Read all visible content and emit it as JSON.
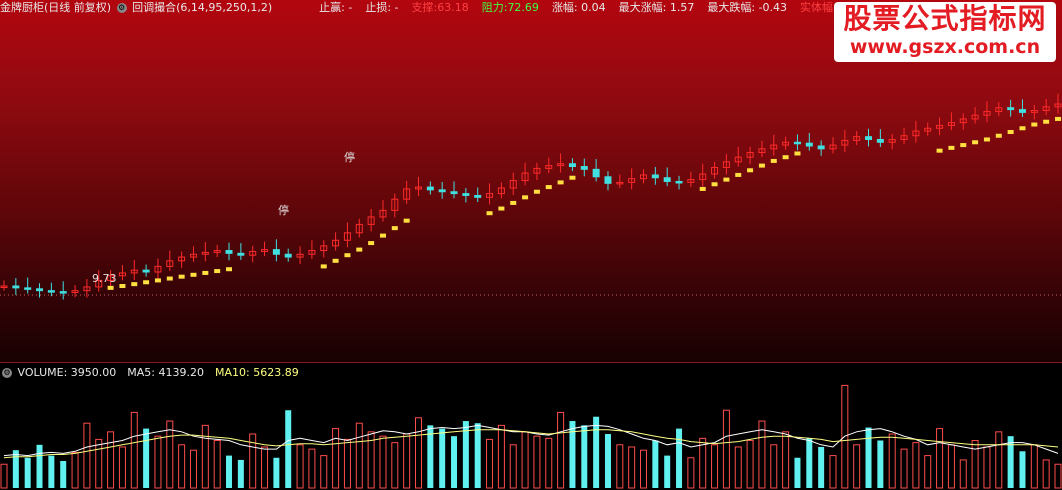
{
  "header": {
    "stock_name": "金牌厨柜(日线 前复权)",
    "indicator_name": "回调撮合(6,14,95,250,1,2)",
    "take_profit": "止赢: -",
    "stop_loss": "止损: -",
    "support_label": "支撑: ",
    "support_value": "63.18",
    "resistance_label": "阻力: ",
    "resistance_value": "72.69",
    "change": "涨幅: 0.04",
    "max_rise": "最大涨幅: 1.57",
    "max_fall": "最大跌幅: -0.43",
    "body_range": "实体幅: 0.03",
    "colors": {
      "support": "#ff4040",
      "resistance": "#40ff40",
      "bodyrange": "#ff4040"
    }
  },
  "volume_header": {
    "volume": "VOLUME: 3950.00",
    "ma5": "MA5: 4139.20",
    "ma10": "MA10: 5623.89",
    "colors": {
      "volume": "#e8e8e8",
      "ma5": "#e8e8e8",
      "ma10": "#ffff80"
    }
  },
  "watermark": {
    "title": "股票公式指标网",
    "url": "www.gszx.com.cn"
  },
  "chart_data": {
    "type": "candlestick",
    "low_label": "9.73",
    "signal_labels": [
      "停",
      "停"
    ],
    "up_color": "#ff2a2a",
    "down_color": "#40e0e0",
    "trend_color": "#ffe040",
    "volume_up_color": "#ff4d4d",
    "volume_down_color": "#60f0f0",
    "price_range": [
      60,
      90
    ],
    "volume_range": [
      0,
      100
    ],
    "price_path": [
      61.5,
      61.3,
      61.2,
      61.0,
      60.9,
      60.8,
      61.0,
      61.4,
      62.1,
      62.6,
      62.9,
      63.2,
      63.0,
      63.6,
      64.2,
      64.6,
      64.9,
      65.1,
      65.3,
      65.0,
      64.8,
      65.2,
      65.4,
      64.9,
      64.6,
      64.9,
      65.3,
      65.8,
      66.4,
      67.2,
      68.1,
      68.9,
      69.6,
      70.8,
      71.9,
      72.1,
      71.8,
      71.6,
      71.4,
      71.2,
      71.0,
      71.4,
      72.0,
      72.8,
      73.6,
      74.1,
      74.4,
      74.6,
      74.3,
      74.0,
      73.2,
      72.5,
      72.6,
      73.0,
      73.4,
      73.1,
      72.7,
      72.6,
      72.9,
      73.5,
      74.2,
      74.8,
      75.3,
      75.8,
      76.2,
      76.6,
      76.9,
      76.8,
      76.5,
      76.2,
      76.6,
      77.1,
      77.5,
      77.2,
      76.9,
      77.2,
      77.6,
      78.1,
      78.4,
      78.7,
      79.0,
      79.4,
      79.8,
      80.2,
      80.6,
      80.4,
      80.1,
      80.3,
      80.7,
      81.0
    ],
    "trend_path": [
      null,
      null,
      null,
      null,
      null,
      null,
      null,
      null,
      null,
      61.3,
      61.5,
      61.7,
      61.9,
      62.1,
      62.3,
      62.5,
      62.7,
      62.9,
      63.1,
      63.3,
      null,
      null,
      null,
      null,
      null,
      null,
      null,
      63.6,
      64.2,
      64.8,
      65.4,
      66.1,
      66.9,
      67.7,
      68.5,
      null,
      null,
      null,
      null,
      null,
      null,
      69.3,
      69.8,
      70.4,
      71.0,
      71.6,
      72.1,
      72.6,
      73.1,
      null,
      null,
      null,
      null,
      null,
      null,
      null,
      null,
      null,
      null,
      71.9,
      72.4,
      72.9,
      73.4,
      73.9,
      74.4,
      74.9,
      75.3,
      75.7,
      null,
      null,
      null,
      null,
      null,
      null,
      null,
      null,
      null,
      null,
      null,
      76.0,
      76.3,
      76.6,
      76.9,
      77.2,
      77.6,
      78.0,
      78.4,
      78.8,
      79.1,
      79.4,
      79.7,
      80.0
    ],
    "volume": [
      22,
      35,
      28,
      40,
      30,
      25,
      33,
      60,
      45,
      52,
      38,
      70,
      55,
      48,
      62,
      40,
      35,
      58,
      44,
      30,
      26,
      50,
      38,
      28,
      72,
      40,
      36,
      30,
      55,
      45,
      60,
      52,
      48,
      42,
      50,
      65,
      58,
      55,
      48,
      62,
      60,
      45,
      58,
      40,
      52,
      48,
      46,
      70,
      62,
      58,
      66,
      50,
      40,
      38,
      35,
      44,
      30,
      55,
      28,
      46,
      40,
      72,
      38,
      44,
      62,
      40,
      52,
      28,
      46,
      38,
      30,
      95,
      40,
      56,
      44,
      50,
      36,
      42,
      30,
      55,
      40,
      26,
      44,
      38,
      52,
      48,
      34,
      40,
      26,
      22
    ],
    "ma5": [
      30,
      31,
      30,
      32,
      33,
      32,
      34,
      38,
      40,
      42,
      44,
      48,
      50,
      52,
      54,
      52,
      48,
      46,
      45,
      44,
      40,
      38,
      36,
      36,
      44,
      46,
      44,
      42,
      46,
      44,
      47,
      50,
      53,
      52,
      50,
      52,
      55,
      56,
      55,
      56,
      58,
      56,
      54,
      52,
      52,
      50,
      49,
      52,
      55,
      57,
      58,
      57,
      54,
      50,
      46,
      44,
      40,
      42,
      38,
      40,
      42,
      48,
      50,
      52,
      54,
      52,
      50,
      46,
      44,
      40,
      38,
      48,
      52,
      54,
      55,
      52,
      48,
      45,
      40,
      42,
      40,
      38,
      36,
      38,
      40,
      42,
      42,
      40,
      36,
      32
    ],
    "ma10": [
      28,
      29,
      29,
      30,
      31,
      31,
      32,
      34,
      36,
      38,
      40,
      42,
      44,
      46,
      48,
      49,
      49,
      48,
      47,
      46,
      44,
      42,
      40,
      39,
      40,
      41,
      41,
      40,
      41,
      42,
      43,
      44,
      46,
      47,
      48,
      49,
      50,
      51,
      52,
      53,
      54,
      54,
      54,
      53,
      52,
      51,
      50,
      51,
      52,
      53,
      54,
      54,
      53,
      52,
      50,
      48,
      46,
      45,
      43,
      42,
      41,
      42,
      43,
      45,
      47,
      48,
      48,
      47,
      46,
      45,
      43,
      44,
      45,
      46,
      47,
      47,
      46,
      45,
      44,
      43,
      42,
      41,
      40,
      40,
      40,
      40,
      40,
      40,
      39,
      38
    ]
  }
}
